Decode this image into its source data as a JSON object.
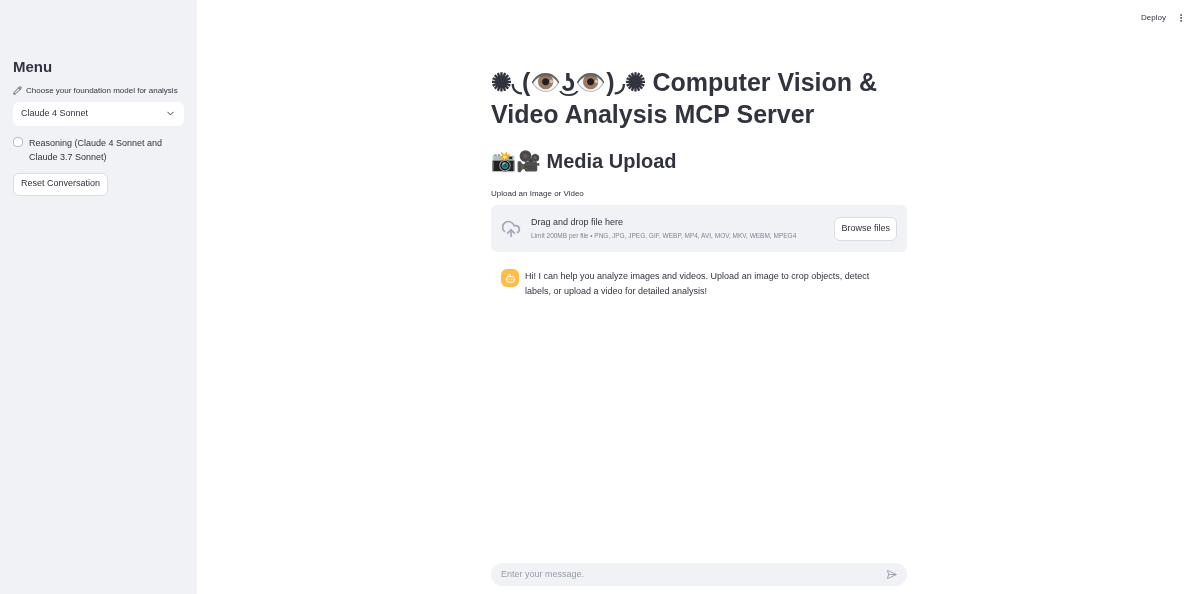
{
  "sidebar": {
    "title": "Menu",
    "model_label": "Choose your foundation model for analysis",
    "model_select": {
      "value": "Claude 4 Sonnet"
    },
    "reasoning": {
      "label": "Reasoning (Claude 4 Sonnet and Claude 3.7 Sonnet)",
      "checked": false
    },
    "reset_button": "Reset Conversation"
  },
  "header": {
    "deploy": "Deploy"
  },
  "main": {
    "title": "✺◟(👁️͜ʖ👁️)◞✺ Computer Vision & Video Analysis MCP Server",
    "section_heading": "📸🎥 Media Upload",
    "uploader": {
      "label": "Upload an Image or Video",
      "drop_text": "Drag and drop file here",
      "limits": "Limit 200MB per file • PNG, JPG, JPEG, GIF, WEBP, MP4, AVI, MOV, MKV, WEBM, MPEG4",
      "browse_button": "Browse files"
    },
    "messages": [
      {
        "kind": "assistant",
        "text": "Hi! I can help you analyze images and videos. Upload an image to crop objects, detect labels, or upload a video for detailed analysis!"
      }
    ],
    "chat_input": {
      "placeholder": "Enter your message."
    }
  }
}
